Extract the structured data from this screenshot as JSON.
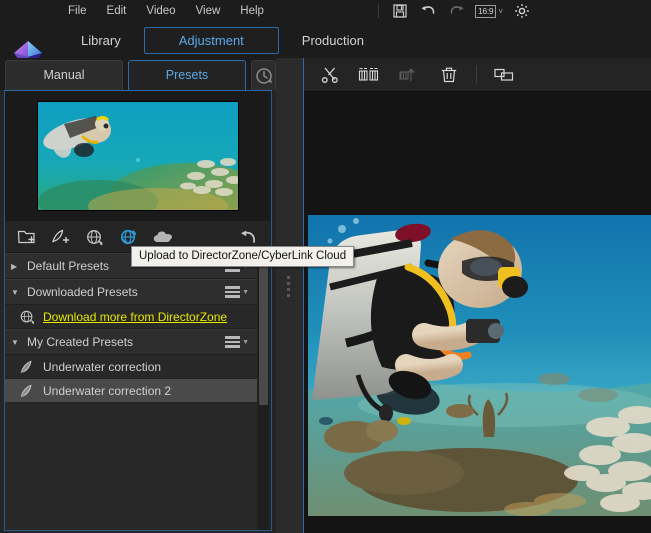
{
  "menubar": {
    "items": [
      "File",
      "Edit",
      "Video",
      "View",
      "Help"
    ],
    "tools": {
      "save": "save-icon",
      "undo": "undo-icon",
      "redo": "redo-icon",
      "aspect_ratio": "16:9",
      "aspect_caret": "˅",
      "settings": "gear-icon"
    }
  },
  "main_tabs": [
    {
      "label": "Library",
      "active": false
    },
    {
      "label": "Adjustment",
      "active": true
    },
    {
      "label": "Production",
      "active": false
    }
  ],
  "left_panel": {
    "sub_tabs": [
      {
        "label": "Manual",
        "active": false
      },
      {
        "label": "Presets",
        "active": true
      }
    ],
    "history_button": "clock-icon",
    "toolbar": [
      {
        "name": "new-preset-folder-icon",
        "label": "New Preset Folder"
      },
      {
        "name": "new-preset-icon",
        "label": "New Preset"
      },
      {
        "name": "download-from-directorzone-icon",
        "label": "Download from DirectorZone"
      },
      {
        "name": "upload-to-directorzone-icon",
        "label": "Upload to DirectorZone/CyberLink Cloud",
        "highlighted": true
      },
      {
        "name": "cloud-icon",
        "label": "CyberLink Cloud"
      },
      {
        "name": "reset-icon",
        "label": "Reset"
      }
    ],
    "groups": [
      {
        "title": "Default Presets",
        "expanded": false,
        "triangle": "▶",
        "items": []
      },
      {
        "title": "Downloaded Presets",
        "expanded": true,
        "triangle": "▼",
        "items": [
          {
            "label": "Download more from DirectorZone",
            "icon": "globe-download-icon",
            "type": "link",
            "selected": false
          }
        ]
      },
      {
        "title": "My Created Presets",
        "expanded": true,
        "triangle": "▼",
        "items": [
          {
            "label": "Underwater correction",
            "icon": "feather-icon",
            "type": "preset",
            "selected": false
          },
          {
            "label": "Underwater correction 2",
            "icon": "feather-icon",
            "type": "preset",
            "selected": true
          }
        ]
      }
    ]
  },
  "right_panel": {
    "toolbar": [
      {
        "name": "cut-scissors-icon",
        "label": "Cut",
        "disabled": false
      },
      {
        "name": "split-clips-icon",
        "label": "Split Clips",
        "disabled": false
      },
      {
        "name": "trim-icon",
        "label": "Trim",
        "disabled": true
      },
      {
        "name": "delete-trash-icon",
        "label": "Delete",
        "disabled": false
      },
      {
        "name": "picture-in-picture-icon",
        "label": "Picture in Picture",
        "disabled": false
      }
    ]
  },
  "tooltip": {
    "text": "Upload to DirectorZone/CyberLink Cloud"
  },
  "colors": {
    "accent_blue": "#5aa8e8",
    "tab_border_blue": "#2a6ba8",
    "link_yellow": "#e8e800",
    "highlight_icon_blue": "#2f9bd8",
    "panel_bg": "#252525",
    "selected_row": "#4a4a4a"
  }
}
